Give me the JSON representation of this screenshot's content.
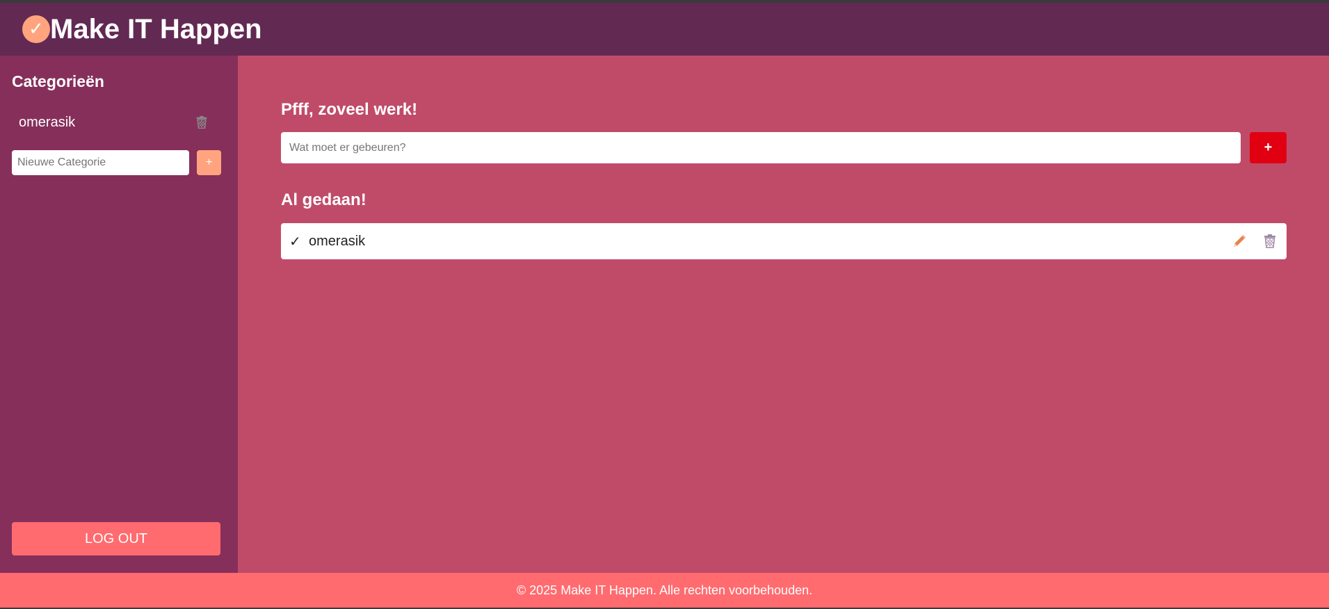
{
  "header": {
    "logo_glyph": "✓",
    "title": "Make IT Happen"
  },
  "sidebar": {
    "heading": "Categorieën",
    "categories": [
      {
        "label": "omerasik",
        "delete_icon": "trash-icon"
      }
    ],
    "new_category": {
      "placeholder": "Nieuwe Categorie",
      "value": "",
      "add_label": "+"
    },
    "logout_label": "LOG OUT"
  },
  "main": {
    "todo_heading": "Pfff, zoveel werk!",
    "task_input": {
      "placeholder": "Wat moet er gebeuren?",
      "value": ""
    },
    "task_add_label": "+",
    "done_heading": "Al gedaan!",
    "done_items": [
      {
        "check": "✓",
        "label": "omerasik",
        "edit_icon": "pencil-icon",
        "delete_icon": "trash-icon"
      }
    ]
  },
  "footer": {
    "text": "© 2025 Make IT Happen. Alle rechten voorbehouden."
  },
  "colors": {
    "header_bg": "#622953",
    "sidebar_bg": "#862f5b",
    "main_bg": "#c04b68",
    "accent_orange": "#ffa47e",
    "add_red": "#e00012",
    "footer_bg": "#ff6b6f"
  }
}
